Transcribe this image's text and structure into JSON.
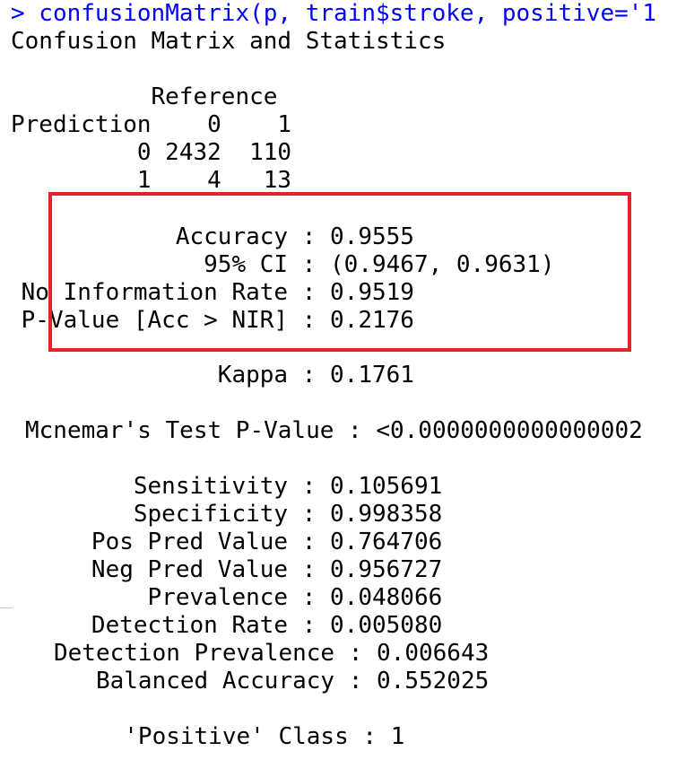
{
  "console": {
    "prompt_symbol": ">",
    "command": " confusionMatrix(p, train$stroke, positive='1",
    "title": "Confusion Matrix and Statistics",
    "matrix": {
      "reference_header": "          Reference",
      "header_row": "Prediction    0    1",
      "rows": [
        "         0 2432  110",
        "         1    4   13"
      ]
    },
    "highlighted_stats": [
      "            Accuracy : 0.9555",
      "              95% CI : (0.9467, 0.9631)",
      " No Information Rate : 0.9519",
      " P-Value [Acc > NIR] : 0.2176"
    ],
    "kappa": "               Kappa : 0.1761",
    "mcnemar": "Mcnemar's Test P-Value : <0.0000000000000002",
    "class_stats": [
      "         Sensitivity : 0.105691",
      "         Specificity : 0.998358",
      "      Pos Pred Value : 0.764706",
      "      Neg Pred Value : 0.956727",
      "          Prevalence : 0.048066",
      "      Detection Rate : 0.005080",
      "Detection Prevalence : 0.006643",
      "   Balanced Accuracy : 0.552025"
    ],
    "positive_class": "     'Positive' Class : 1"
  },
  "colors": {
    "command": "#0000ff",
    "text": "#000000",
    "highlight_border": "#e0242c"
  }
}
